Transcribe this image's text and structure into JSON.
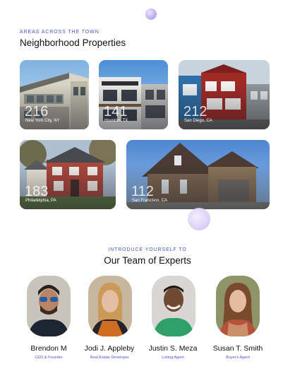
{
  "neighborhoods": {
    "eyebrow": "AREAS ACROSS THE TOWN",
    "title": "Neighborhood Properties",
    "cards": [
      {
        "count": "216",
        "city": "New York City, NY"
      },
      {
        "count": "141",
        "city": "Houston, TX"
      },
      {
        "count": "212",
        "city": "San Diego, CA"
      },
      {
        "count": "183",
        "city": "Philadelphia, PA"
      },
      {
        "count": "112",
        "city": "San Francisco, CA"
      }
    ]
  },
  "team": {
    "eyebrow": "INTRODUCE YOURSELF TO",
    "title": "Our Team of Experts",
    "members": [
      {
        "name": "Brendon M",
        "role": "CEO & Founder"
      },
      {
        "name": "Jodi J. Appleby",
        "role": "Real Estate Developer"
      },
      {
        "name": "Justin S. Meza",
        "role": "Listing Agent"
      },
      {
        "name": "Susan T. Smith",
        "role": "Buyer's Agent"
      }
    ]
  }
}
